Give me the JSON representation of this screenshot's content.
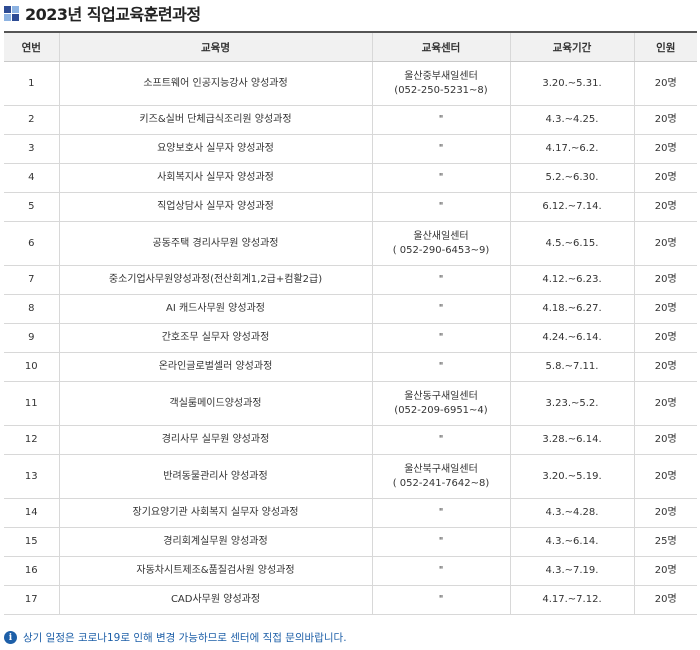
{
  "title": "2023년 직업교육훈련과정",
  "headers": [
    "연번",
    "교육명",
    "교육센터",
    "교육기간",
    "인원"
  ],
  "rows": [
    {
      "no": "1",
      "name": "소프트웨어 인공지능강사 양성과정",
      "center": "울산중부새일센터",
      "phone": "(052-250-5231~8)",
      "period": "3.20.~5.31.",
      "count": "20명"
    },
    {
      "no": "2",
      "name": "키즈&실버 단체급식조리원 양성과정",
      "center": "\"",
      "phone": "",
      "period": "4.3.~4.25.",
      "count": "20명"
    },
    {
      "no": "3",
      "name": "요양보호사 실무자 양성과정",
      "center": "\"",
      "phone": "",
      "period": "4.17.~6.2.",
      "count": "20명"
    },
    {
      "no": "4",
      "name": "사회복지사 실무자 양성과정",
      "center": "\"",
      "phone": "",
      "period": "5.2.~6.30.",
      "count": "20명"
    },
    {
      "no": "5",
      "name": "직업상담사 실무자 양성과정",
      "center": "\"",
      "phone": "",
      "period": "6.12.~7.14.",
      "count": "20명"
    },
    {
      "no": "6",
      "name": "공동주택 경리사무원 양성과정",
      "center": "울산새일센터",
      "phone": "( 052-290-6453~9)",
      "period": "4.5.~6.15.",
      "count": "20명"
    },
    {
      "no": "7",
      "name": "중소기업사무원양성과정(전산회계1,2급+컴활2급)",
      "center": "\"",
      "phone": "",
      "period": "4.12.~6.23.",
      "count": "20명"
    },
    {
      "no": "8",
      "name": "AI 캐드사무원 양성과정",
      "center": "\"",
      "phone": "",
      "period": "4.18.~6.27.",
      "count": "20명"
    },
    {
      "no": "9",
      "name": "간호조무 실무자 양성과정",
      "center": "\"",
      "phone": "",
      "period": "4.24.~6.14.",
      "count": "20명"
    },
    {
      "no": "10",
      "name": "온라인글로벌셀러 양성과정",
      "center": "\"",
      "phone": "",
      "period": "5.8.~7.11.",
      "count": "20명"
    },
    {
      "no": "11",
      "name": "객실룸메이드양성과정",
      "center": "울산동구새일센터",
      "phone": "(052-209-6951~4)",
      "period": "3.23.~5.2.",
      "count": "20명"
    },
    {
      "no": "12",
      "name": "경리사무 실무원 양성과정",
      "center": "\"",
      "phone": "",
      "period": "3.28.~6.14.",
      "count": "20명"
    },
    {
      "no": "13",
      "name": "반려동물관리사 양성과정",
      "center": "울산북구새일센터",
      "phone": "( 052-241-7642~8)",
      "period": "3.20.~5.19.",
      "count": "20명"
    },
    {
      "no": "14",
      "name": "장기요양기관 사회복지 실무자 양성과정",
      "center": "\"",
      "phone": "",
      "period": "4.3.~4.28.",
      "count": "20명"
    },
    {
      "no": "15",
      "name": "경리회계실무원 양성과정",
      "center": "\"",
      "phone": "",
      "period": "4.3.~6.14.",
      "count": "25명"
    },
    {
      "no": "16",
      "name": "자동차시트제조&품질검사원 양성과정",
      "center": "\"",
      "phone": "",
      "period": "4.3.~7.19.",
      "count": "20명"
    },
    {
      "no": "17",
      "name": "CAD사무원 양성과정",
      "center": "\"",
      "phone": "",
      "period": "4.17.~7.12.",
      "count": "20명"
    }
  ],
  "note": "상기 일정은 코로나19로 인해 변경 가능하므로 센터에 직접 문의바랍니다.",
  "note_icon_glyph": "i",
  "colors": {
    "icon_dark": "#2e4c94",
    "icon_light": "#8db3e2",
    "note": "#1d5fa8",
    "header_bg": "#f1f1f1"
  }
}
